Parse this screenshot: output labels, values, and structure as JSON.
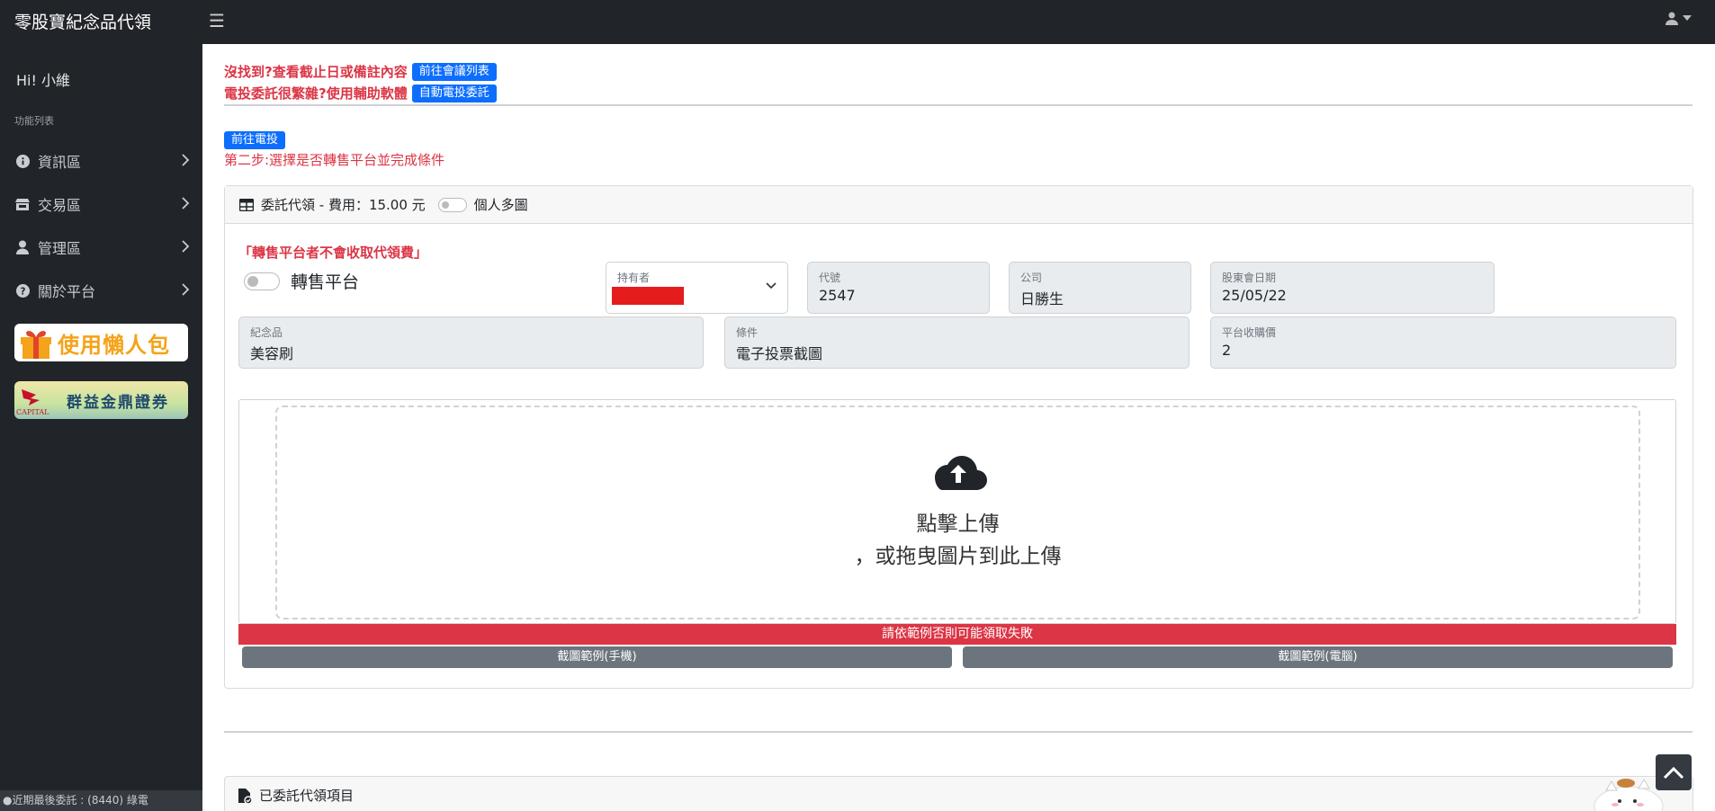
{
  "app": {
    "brand": "零股寶紀念品代領"
  },
  "sidebar": {
    "greeting": "Hi! 小維",
    "heading": "功能列表",
    "items": [
      {
        "label": "資訊區",
        "icon": "info-circle-icon"
      },
      {
        "label": "交易區",
        "icon": "store-icon"
      },
      {
        "label": "管理區",
        "icon": "user-icon"
      },
      {
        "label": "關於平台",
        "icon": "question-circle-icon"
      }
    ],
    "banner_1": "使用懶人包",
    "banner_2": "群益金鼎證券",
    "banner_2_logo": "CAPITAL",
    "footer": "●近期最後委託 : (8440) 綠電"
  },
  "notices": {
    "line1_text": "沒找到?查看截止日或備註內容",
    "line1_button": "前往會議列表",
    "line2_text": "電投委託很繁雜?使用輔助軟體",
    "line2_button": "自動電投委託"
  },
  "step": {
    "button": "前往電投",
    "text": "第二步:選擇是否轉售平台並完成條件"
  },
  "card": {
    "title": "委託代領 - 費用：15.00 元",
    "multi_toggle_label": "個人多圖",
    "warning": "「轉售平台者不會收取代領費」",
    "resale_label": "轉售平台",
    "fields": {
      "holder_label": "持有者",
      "code_label": "代號",
      "code_value": "2547",
      "company_label": "公司",
      "company_value": "日勝生",
      "meeting_label": "股東會日期",
      "meeting_value": "25/05/22",
      "souvenir_label": "紀念品",
      "souvenir_value": "美容刷",
      "condition_label": "條件",
      "condition_value": "電子投票截圖",
      "price_label": "平台收購價",
      "price_value": "2"
    },
    "upload": {
      "line1": "點擊上傳",
      "line2": "，或拖曳圖片到此上傳"
    },
    "alert": "請依範例否則可能領取失敗",
    "example_mobile": "截圖範例(手機)",
    "example_pc": "截圖範例(電腦)"
  },
  "card2": {
    "title": "已委託代領項目"
  },
  "colors": {
    "danger": "#dc3545",
    "primary": "#0d6efd",
    "dark": "#212529",
    "secondary": "#6c757d"
  }
}
